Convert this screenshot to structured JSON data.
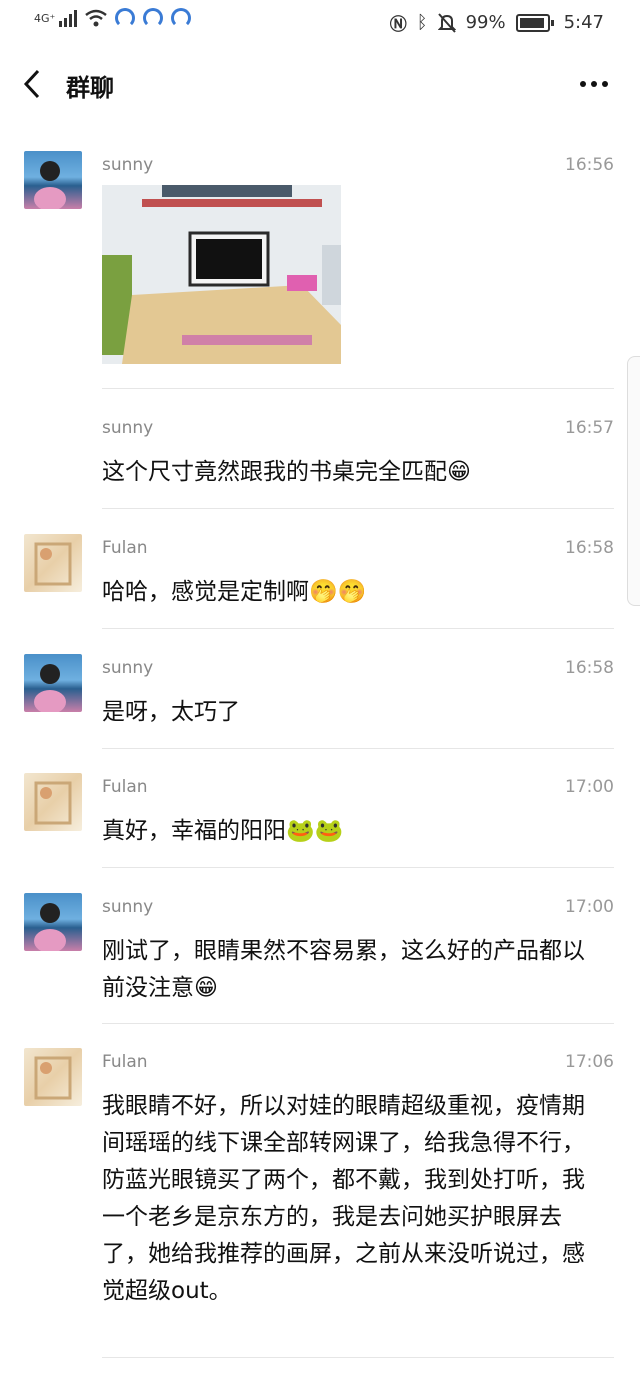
{
  "status": {
    "network": "4G⁺",
    "battery_pct": "99%",
    "time": "5:47"
  },
  "header": {
    "back_icon": "chevron-left-icon",
    "title": "群聊",
    "more_icon": "more-horizontal-icon"
  },
  "messages": [
    {
      "sender": "sunny",
      "time": "16:56",
      "type": "image",
      "text": ""
    },
    {
      "sender": "sunny",
      "time": "16:57",
      "type": "text",
      "text": "这个尺寸竟然跟我的书桌完全匹配😁"
    },
    {
      "sender": "Fulan",
      "time": "16:58",
      "type": "text",
      "text": "哈哈，感觉是定制啊🤭🤭"
    },
    {
      "sender": "sunny",
      "time": "16:58",
      "type": "text",
      "text": "是呀，太巧了"
    },
    {
      "sender": "Fulan",
      "time": "17:00",
      "type": "text",
      "text": "真好，幸福的阳阳🐸🐸"
    },
    {
      "sender": "sunny",
      "time": "17:00",
      "type": "text",
      "text": "刚试了，眼睛果然不容易累，这么好的产品都以前没注意😁"
    },
    {
      "sender": "Fulan",
      "time": "17:06",
      "type": "text",
      "text": "我眼睛不好，所以对娃的眼睛超级重视，疫情期间瑶瑶的线下课全部转网课了，给我急得不行，防蓝光眼镜买了两个，都不戴，我到处打听，我一个老乡是京东方的，我是去问她买护眼屏去了，她给我推荐的画屏，之前从来没听说过，感觉超级out。"
    }
  ]
}
